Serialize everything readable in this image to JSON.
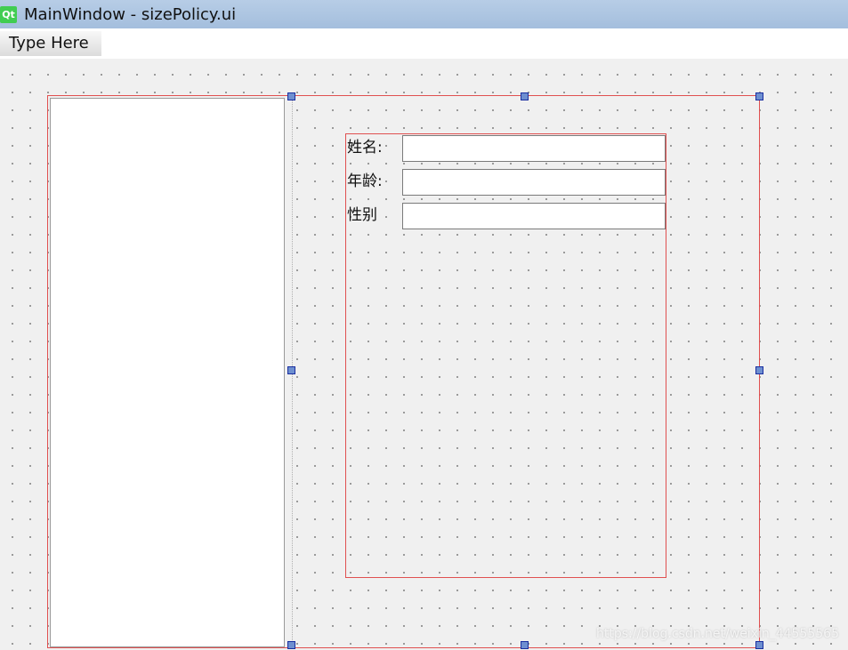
{
  "window": {
    "title": "MainWindow - sizePolicy.ui",
    "logo_text": "Qt"
  },
  "menubar": {
    "placeholder_item": "Type Here"
  },
  "form": {
    "fields": [
      {
        "label": "姓名:",
        "value": ""
      },
      {
        "label": "年龄:",
        "value": ""
      },
      {
        "label": "性别",
        "value": ""
      }
    ]
  },
  "watermark": "https://blog.csdn.net/weixin_44555565",
  "colors": {
    "title_bar": "#a4bedd",
    "selection_border": "#e05050",
    "handle_fill": "#6e8fd0",
    "handle_border": "#1a2fa0",
    "qt_green": "#41cd52"
  }
}
